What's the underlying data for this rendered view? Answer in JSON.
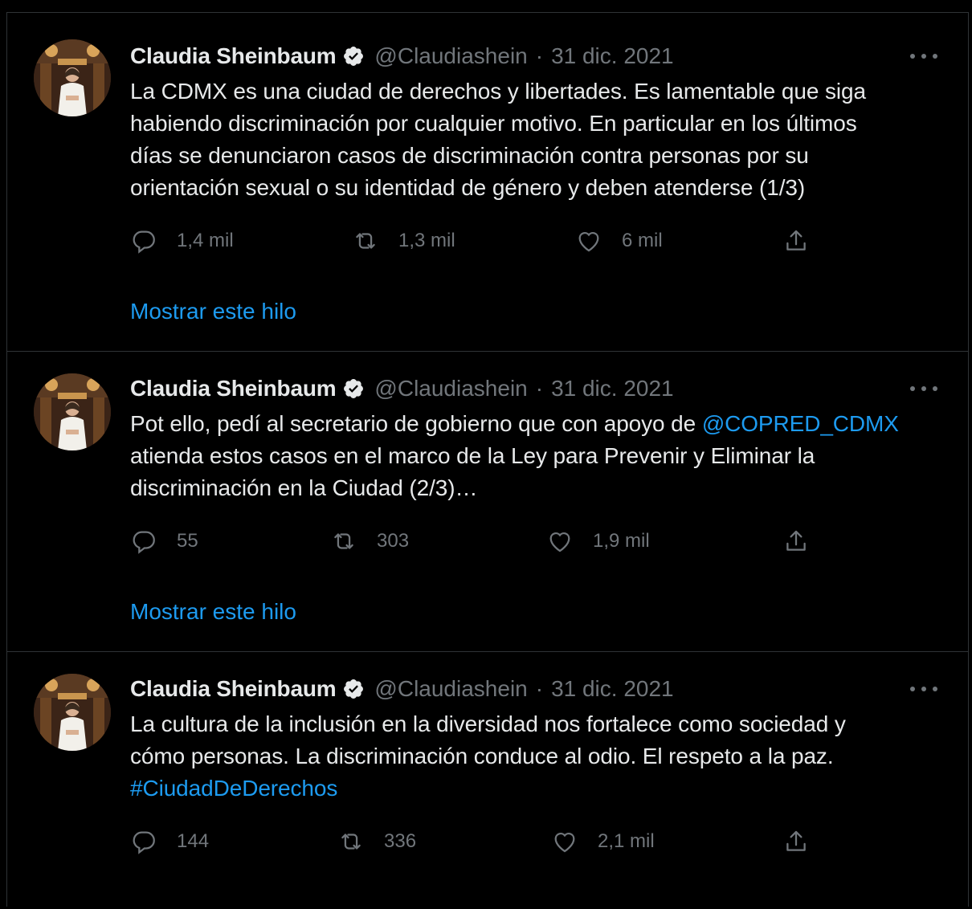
{
  "colors": {
    "background": "#000000",
    "text": "#e7e9ea",
    "muted": "#71767b",
    "link": "#1d9bf0",
    "border": "#2f3336"
  },
  "tweets": [
    {
      "author_name": "Claudia Sheinbaum",
      "handle": "@Claudiashein",
      "separator": "·",
      "date": "31 dic. 2021",
      "verified_icon": "verified-badge-icon",
      "text_lines": [
        "La CDMX es una ciudad de derechos y libertades. Es lamentable que siga",
        "habiendo discriminación por cualquier motivo. En particular en los últimos",
        "días se denunciaron casos de discriminación contra personas por su",
        "orientación sexual o su identidad de género y deben atenderse (1/3)"
      ],
      "replies": "1,4 mil",
      "retweets": "1,3 mil",
      "likes": "6 mil",
      "thread_link": "Mostrar este hilo"
    },
    {
      "author_name": "Claudia Sheinbaum",
      "handle": "@Claudiashein",
      "separator": "·",
      "date": "31 dic. 2021",
      "verified_icon": "verified-badge-icon",
      "text_pre": "Pot ello, pedí al secretario de gobierno que con apoyo de ",
      "mention": "@COPRED_CDMX",
      "text_lines_after": [
        "atienda estos casos en el marco de la Ley para Prevenir y Eliminar la",
        "discriminación en la Ciudad (2/3)…"
      ],
      "replies": "55",
      "retweets": "303",
      "likes": "1,9 mil",
      "thread_link": "Mostrar este hilo"
    },
    {
      "author_name": "Claudia Sheinbaum",
      "handle": "@Claudiashein",
      "separator": "·",
      "date": "31 dic. 2021",
      "verified_icon": "verified-badge-icon",
      "text_lines": [
        "La cultura de la inclusión en la diversidad nos fortalece como sociedad y",
        "cómo personas. La discriminación conduce al odio. El respeto a la paz."
      ],
      "hashtag": "#CiudadDeDerechos",
      "replies": "144",
      "retweets": "336",
      "likes": "2,1 mil"
    }
  ]
}
